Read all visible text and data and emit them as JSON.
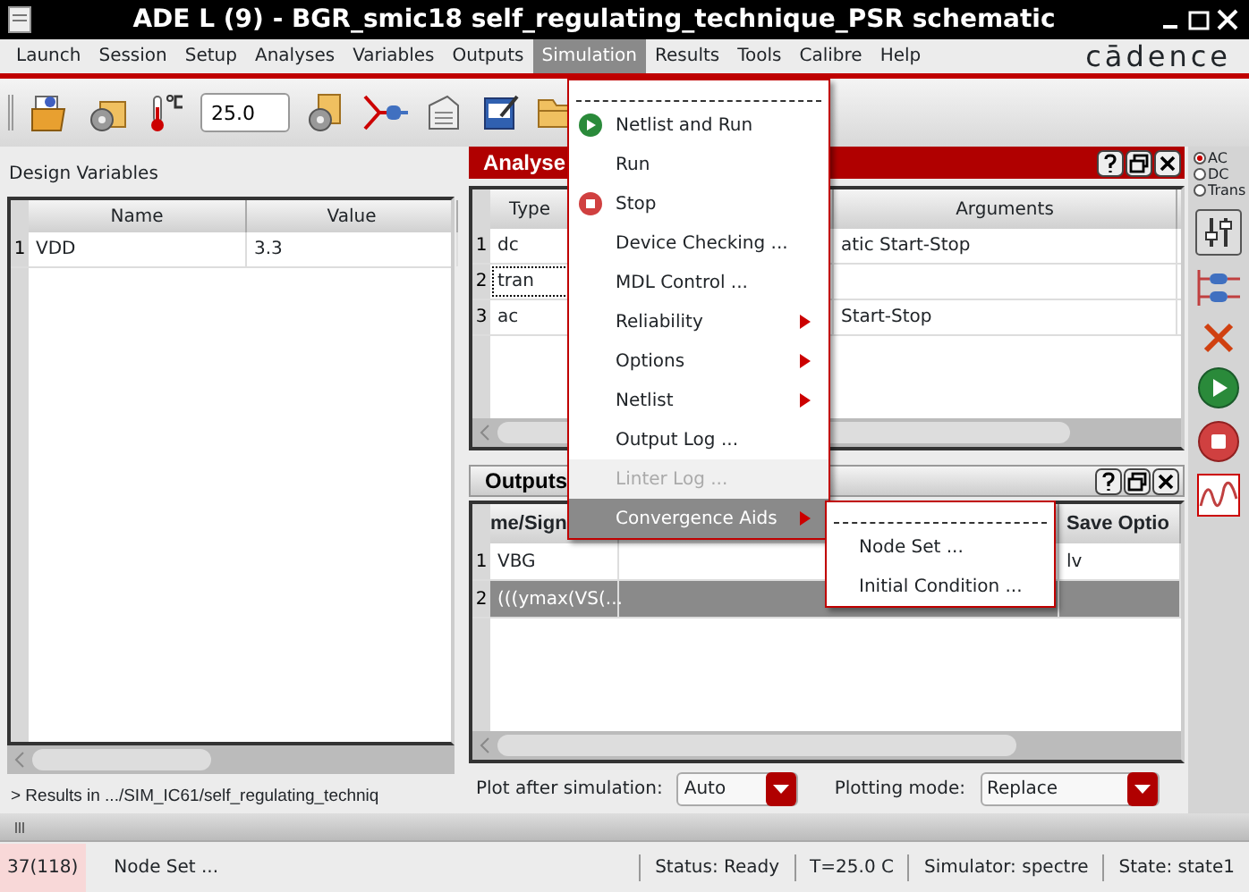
{
  "window": {
    "title": "ADE L (9) - BGR_smic18 self_regulating_technique_PSR schematic"
  },
  "menu_bar": [
    {
      "label": "Launch",
      "selected": false
    },
    {
      "label": "Session",
      "selected": false
    },
    {
      "label": "Setup",
      "selected": false
    },
    {
      "label": "Analyses",
      "selected": false
    },
    {
      "label": "Variables",
      "selected": false
    },
    {
      "label": "Outputs",
      "selected": false
    },
    {
      "label": "Simulation",
      "selected": true
    },
    {
      "label": "Results",
      "selected": false
    },
    {
      "label": "Tools",
      "selected": false
    },
    {
      "label": "Calibre",
      "selected": false
    },
    {
      "label": "Help",
      "selected": false
    }
  ],
  "logo": "cādence",
  "toolbar": {
    "temperature": "25.0"
  },
  "design_variables": {
    "title": "Design Variables",
    "columns": [
      "Name",
      "Value"
    ],
    "rows": [
      {
        "index": "1",
        "cells": [
          "VDD",
          "3.3"
        ]
      }
    ]
  },
  "analyses": {
    "title": "Analyse",
    "columns": [
      "Type",
      "Arguments"
    ],
    "rows": [
      {
        "index": "1",
        "type": "dc",
        "arguments": "atic Start-Stop",
        "focused": false
      },
      {
        "index": "2",
        "type": "tran",
        "arguments": "",
        "focused": true
      },
      {
        "index": "3",
        "type": "ac",
        "arguments": "Start-Stop",
        "focused": false
      }
    ]
  },
  "outputs": {
    "title": "Outputs",
    "columns": [
      "me/Sign",
      "Save Optio"
    ],
    "rows": [
      {
        "index": "1",
        "cells": [
          "VBG",
          "lv"
        ],
        "selected": false
      },
      {
        "index": "2",
        "cells": [
          "(((ymax(VS(...",
          ""
        ],
        "selected": true
      }
    ],
    "plot_after": {
      "label": "Plot after simulation:",
      "value": "Auto"
    },
    "plotting_mode": {
      "label": "Plotting mode:",
      "value": "Replace"
    }
  },
  "analysis_radio": [
    {
      "label": "AC",
      "selected": true
    },
    {
      "label": "DC",
      "selected": false
    },
    {
      "label": "Trans",
      "selected": false
    }
  ],
  "results_line": "> Results in .../SIM_IC61/self_regulating_techniq",
  "status_bar": {
    "count": "37(118)",
    "message": "Node Set ...",
    "fields": [
      "Status: Ready",
      "T=25.0  C",
      "Simulator: spectre",
      "State: state1"
    ]
  },
  "simulation_menu": [
    {
      "label": "Netlist and Run",
      "kind": "play",
      "submenu": false,
      "disabled": false,
      "selected": false
    },
    {
      "label": "Run",
      "kind": "plain",
      "submenu": false,
      "disabled": false,
      "selected": false
    },
    {
      "label": "Stop",
      "kind": "stop",
      "submenu": false,
      "disabled": false,
      "selected": false
    },
    {
      "label": "Device Checking ...",
      "kind": "plain",
      "submenu": false,
      "disabled": false,
      "selected": false
    },
    {
      "label": "MDL Control ...",
      "kind": "plain",
      "submenu": false,
      "disabled": false,
      "selected": false
    },
    {
      "label": "Reliability",
      "kind": "plain",
      "submenu": true,
      "disabled": false,
      "selected": false
    },
    {
      "label": "Options",
      "kind": "plain",
      "submenu": true,
      "disabled": false,
      "selected": false
    },
    {
      "label": "Netlist",
      "kind": "plain",
      "submenu": true,
      "disabled": false,
      "selected": false
    },
    {
      "label": "Output Log ...",
      "kind": "plain",
      "submenu": false,
      "disabled": false,
      "selected": false
    },
    {
      "label": "Linter Log ...",
      "kind": "plain",
      "submenu": false,
      "disabled": true,
      "selected": false
    },
    {
      "label": "Convergence Aids",
      "kind": "plain",
      "submenu": true,
      "disabled": false,
      "selected": true
    }
  ],
  "convergence_submenu": [
    {
      "label": "Node Set ..."
    },
    {
      "label": "Initial Condition ..."
    }
  ]
}
